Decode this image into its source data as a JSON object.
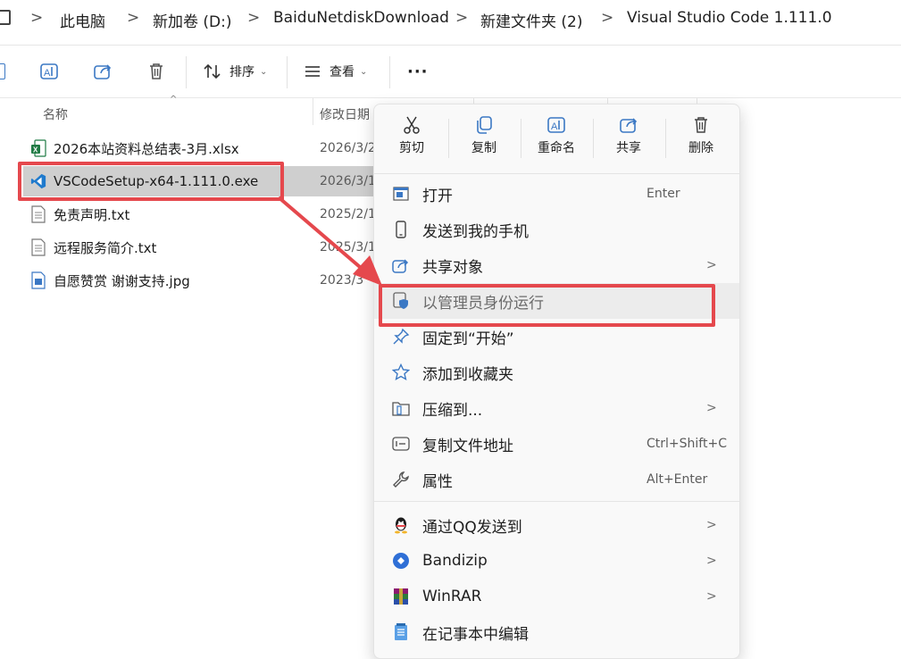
{
  "breadcrumb": [
    "此电脑",
    "新加卷 (D:)",
    "BaiduNetdiskDownload",
    "新建文件夹 (2)",
    "Visual Studio Code 1.111.0"
  ],
  "toolbar": {
    "sort_label": "排序",
    "view_label": "查看",
    "more_label": "···"
  },
  "columns": {
    "name": "名称",
    "modified": "修改日期"
  },
  "files": [
    {
      "name": "2026本站资料总结表-3月.xlsx",
      "date": "2026/3/2",
      "icon": "excel-icon"
    },
    {
      "name": "VSCodeSetup-x64-1.111.0.exe",
      "date": "2026/3/1",
      "icon": "vscode-icon"
    },
    {
      "name": "免责声明.txt",
      "date": "2025/2/1",
      "icon": "txt-icon"
    },
    {
      "name": "远程服务简介.txt",
      "date": "2025/3/1",
      "icon": "txt-icon"
    },
    {
      "name": "自愿赞赏 谢谢支持.jpg",
      "date": "2023/3",
      "icon": "image-icon"
    }
  ],
  "context_menu": {
    "top_actions": [
      {
        "label": "剪切",
        "icon": "cut-icon"
      },
      {
        "label": "复制",
        "icon": "copy-icon"
      },
      {
        "label": "重命名",
        "icon": "rename-icon"
      },
      {
        "label": "共享",
        "icon": "share-icon"
      },
      {
        "label": "删除",
        "icon": "delete-icon"
      }
    ],
    "items": [
      {
        "label": "打开",
        "shortcut": "Enter",
        "arrow": "",
        "icon": "open-icon"
      },
      {
        "label": "发送到我的手机",
        "shortcut": "",
        "arrow": "",
        "icon": "phone-icon"
      },
      {
        "label": "共享对象",
        "shortcut": "",
        "arrow": ">",
        "icon": "share-with-icon"
      },
      {
        "label": "以管理员身份运行",
        "shortcut": "",
        "arrow": "",
        "icon": "admin-shield-icon"
      },
      {
        "label": "固定到“开始”",
        "shortcut": "",
        "arrow": "",
        "icon": "pin-icon"
      },
      {
        "label": "添加到收藏夹",
        "shortcut": "",
        "arrow": "",
        "icon": "star-icon"
      },
      {
        "label": "压缩到...",
        "shortcut": "",
        "arrow": ">",
        "icon": "zip-icon"
      },
      {
        "label": "复制文件地址",
        "shortcut": "Ctrl+Shift+C",
        "arrow": "",
        "icon": "copy-path-icon"
      },
      {
        "label": "属性",
        "shortcut": "Alt+Enter",
        "arrow": "",
        "icon": "wrench-icon"
      },
      {
        "label": "通过QQ发送到",
        "shortcut": "",
        "arrow": ">",
        "icon": "qq-icon"
      },
      {
        "label": "Bandizip",
        "shortcut": "",
        "arrow": ">",
        "icon": "bandizip-icon"
      },
      {
        "label": "WinRAR",
        "shortcut": "",
        "arrow": ">",
        "icon": "winrar-icon"
      },
      {
        "label": "在记事本中编辑",
        "shortcut": "",
        "arrow": "",
        "icon": "notepad-icon"
      }
    ]
  },
  "colors": {
    "annotation_red": "#e5484d",
    "selection_gray": "#cfcfcf",
    "menu_bg": "#f9f9f9"
  }
}
